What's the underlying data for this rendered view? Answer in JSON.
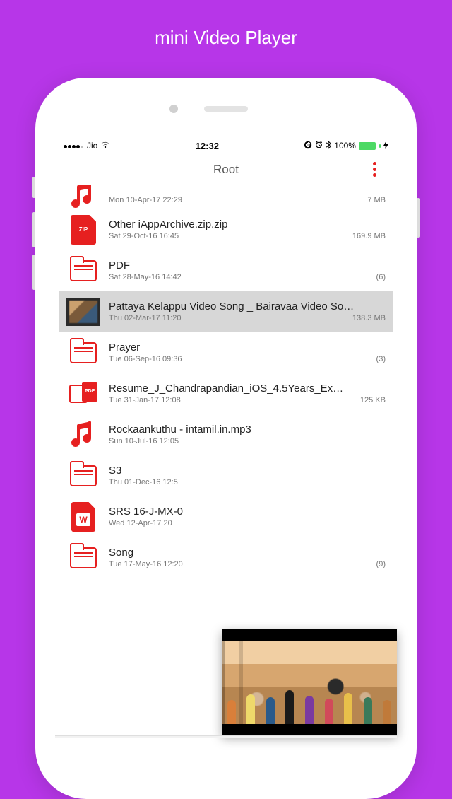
{
  "promo_title": "mini Video Player",
  "statusbar": {
    "carrier": "Jio",
    "wifi_icon": "wifi",
    "time": "12:32",
    "rotation_lock": "⟳",
    "alarm": "⏰",
    "bluetooth": "✱",
    "battery_pct": "100%",
    "charging": "⚡"
  },
  "navbar": {
    "title": "Root"
  },
  "files": [
    {
      "icon": "music",
      "name": "",
      "date": "Mon 10-Apr-17 22:29",
      "size": "7 MB",
      "partial_first": true
    },
    {
      "icon": "zip",
      "name": "Other iAppArchive.zip.zip",
      "date": "Sat 29-Oct-16 16:45",
      "size": "169.9 MB"
    },
    {
      "icon": "folder",
      "name": "PDF",
      "date": "Sat 28-May-16 14:42",
      "size": "(6)"
    },
    {
      "icon": "video",
      "name": "Pattaya Kelappu Video Song _ Bairavaa Video So…",
      "date": "Thu 02-Mar-17 11:20",
      "size": "138.3 MB",
      "selected": true
    },
    {
      "icon": "folder",
      "name": "Prayer",
      "date": "Tue 06-Sep-16 09:36",
      "size": "(3)"
    },
    {
      "icon": "pdf",
      "name": "Resume_J_Chandrapandian_iOS_4.5Years_Ex…",
      "date": "Tue 31-Jan-17 12:08",
      "size": "125 KB"
    },
    {
      "icon": "music",
      "name": "Rockaankuthu - intamil.in.mp3",
      "date": "Sun 10-Jul-16 12:05",
      "size": ""
    },
    {
      "icon": "folder",
      "name": "S3",
      "date": "Thu 01-Dec-16 12:5",
      "size": ""
    },
    {
      "icon": "doc",
      "name": "SRS 16-J-MX-0",
      "date": "Wed 12-Apr-17 20",
      "size": ""
    },
    {
      "icon": "folder",
      "name": "Song",
      "date": "Tue 17-May-16 12:20",
      "size": "(9)"
    }
  ],
  "icon_text": {
    "zip": "ZIP",
    "pdf": "PDF",
    "doc_w": "W"
  }
}
